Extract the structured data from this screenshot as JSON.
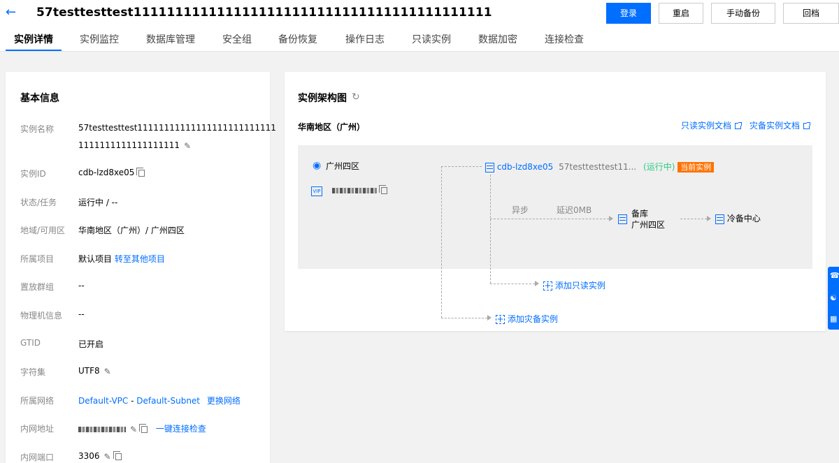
{
  "header": {
    "title": "57testtesttest1111111111111111111111111111111111111111111",
    "buttons": {
      "login": "登录",
      "restart": "重启",
      "manual_backup": "手动备份",
      "rollback": "回档"
    }
  },
  "tabs": [
    "实例详情",
    "实例监控",
    "数据库管理",
    "安全组",
    "备份恢复",
    "操作日志",
    "只读实例",
    "数据加密",
    "连接检查"
  ],
  "basic_info": {
    "title": "基本信息",
    "rows": {
      "name": {
        "label": "实例名称",
        "line1": "57testtesttest11111111111111111111111111",
        "line2": "1111111111111111111"
      },
      "id": {
        "label": "实例ID",
        "value": "cdb-lzd8xe05"
      },
      "status": {
        "label": "状态/任务",
        "value": "运行中 / --"
      },
      "region": {
        "label": "地域/可用区",
        "value": "华南地区（广州）/ 广州四区"
      },
      "project": {
        "label": "所属项目",
        "value": "默认项目",
        "link": "转至其他项目"
      },
      "group": {
        "label": "置放群组",
        "value": "--"
      },
      "machine": {
        "label": "物理机信息",
        "value": "--"
      },
      "gtid": {
        "label": "GTID",
        "value": "已开启"
      },
      "charset": {
        "label": "字符集",
        "value": "UTF8"
      },
      "network": {
        "label": "所属网络",
        "vpc": "Default-VPC",
        "sep": "-",
        "subnet": "Default-Subnet",
        "change": "更换网络"
      },
      "intranet_addr": {
        "label": "内网地址",
        "check": "一键连接检查"
      },
      "intranet_port": {
        "label": "内网端口",
        "value": "3306"
      }
    }
  },
  "architecture": {
    "title": "实例架构图",
    "region": "华南地区（广州）",
    "ro_doc": "只读实例文档",
    "dr_doc": "灾备实例文档",
    "zone": "广州四区",
    "vip_label": "VIP",
    "master": {
      "id": "cdb-lzd8xe05",
      "name": "57testtesttest11...",
      "status": "(运行中)",
      "badge": "当前实例"
    },
    "sync_mode": "异步",
    "delay": "延迟0MB",
    "slave": {
      "line1": "备库",
      "line2": "广州四区"
    },
    "cold": "冷备中心",
    "add_ro": "添加只读实例",
    "add_dr": "添加灾备实例"
  },
  "colors": {
    "primary": "#006eff",
    "running": "#29cc85",
    "badge": "#ff7200"
  }
}
